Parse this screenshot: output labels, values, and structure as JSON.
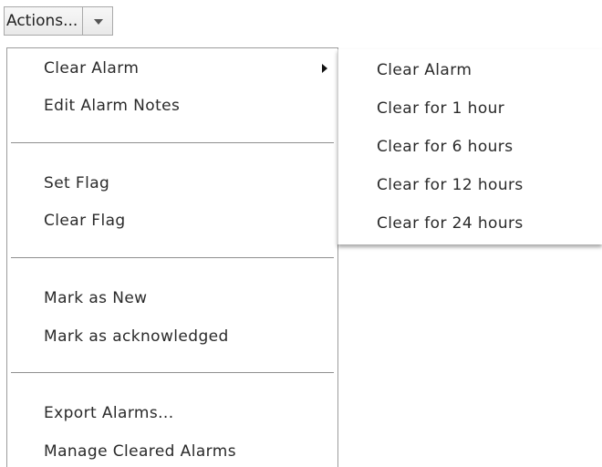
{
  "actions_button": {
    "label": "Actions...",
    "dropdown_icon": "chevron-down-icon"
  },
  "menu": {
    "items": [
      {
        "label": "Clear Alarm",
        "has_submenu": true
      },
      {
        "label": "Edit Alarm Notes"
      },
      {
        "label": "Set Flag"
      },
      {
        "label": "Clear Flag"
      },
      {
        "label": "Mark as New"
      },
      {
        "label": "Mark as acknowledged"
      },
      {
        "label": "Export Alarms..."
      },
      {
        "label": "Manage Cleared Alarms"
      }
    ],
    "submenu_icon": "chevron-right-icon"
  },
  "submenu": {
    "items": [
      {
        "label": "Clear Alarm"
      },
      {
        "label": "Clear for 1 hour"
      },
      {
        "label": "Clear for 6 hours"
      },
      {
        "label": "Clear for 12 hours"
      },
      {
        "label": "Clear for 24 hours"
      }
    ]
  }
}
